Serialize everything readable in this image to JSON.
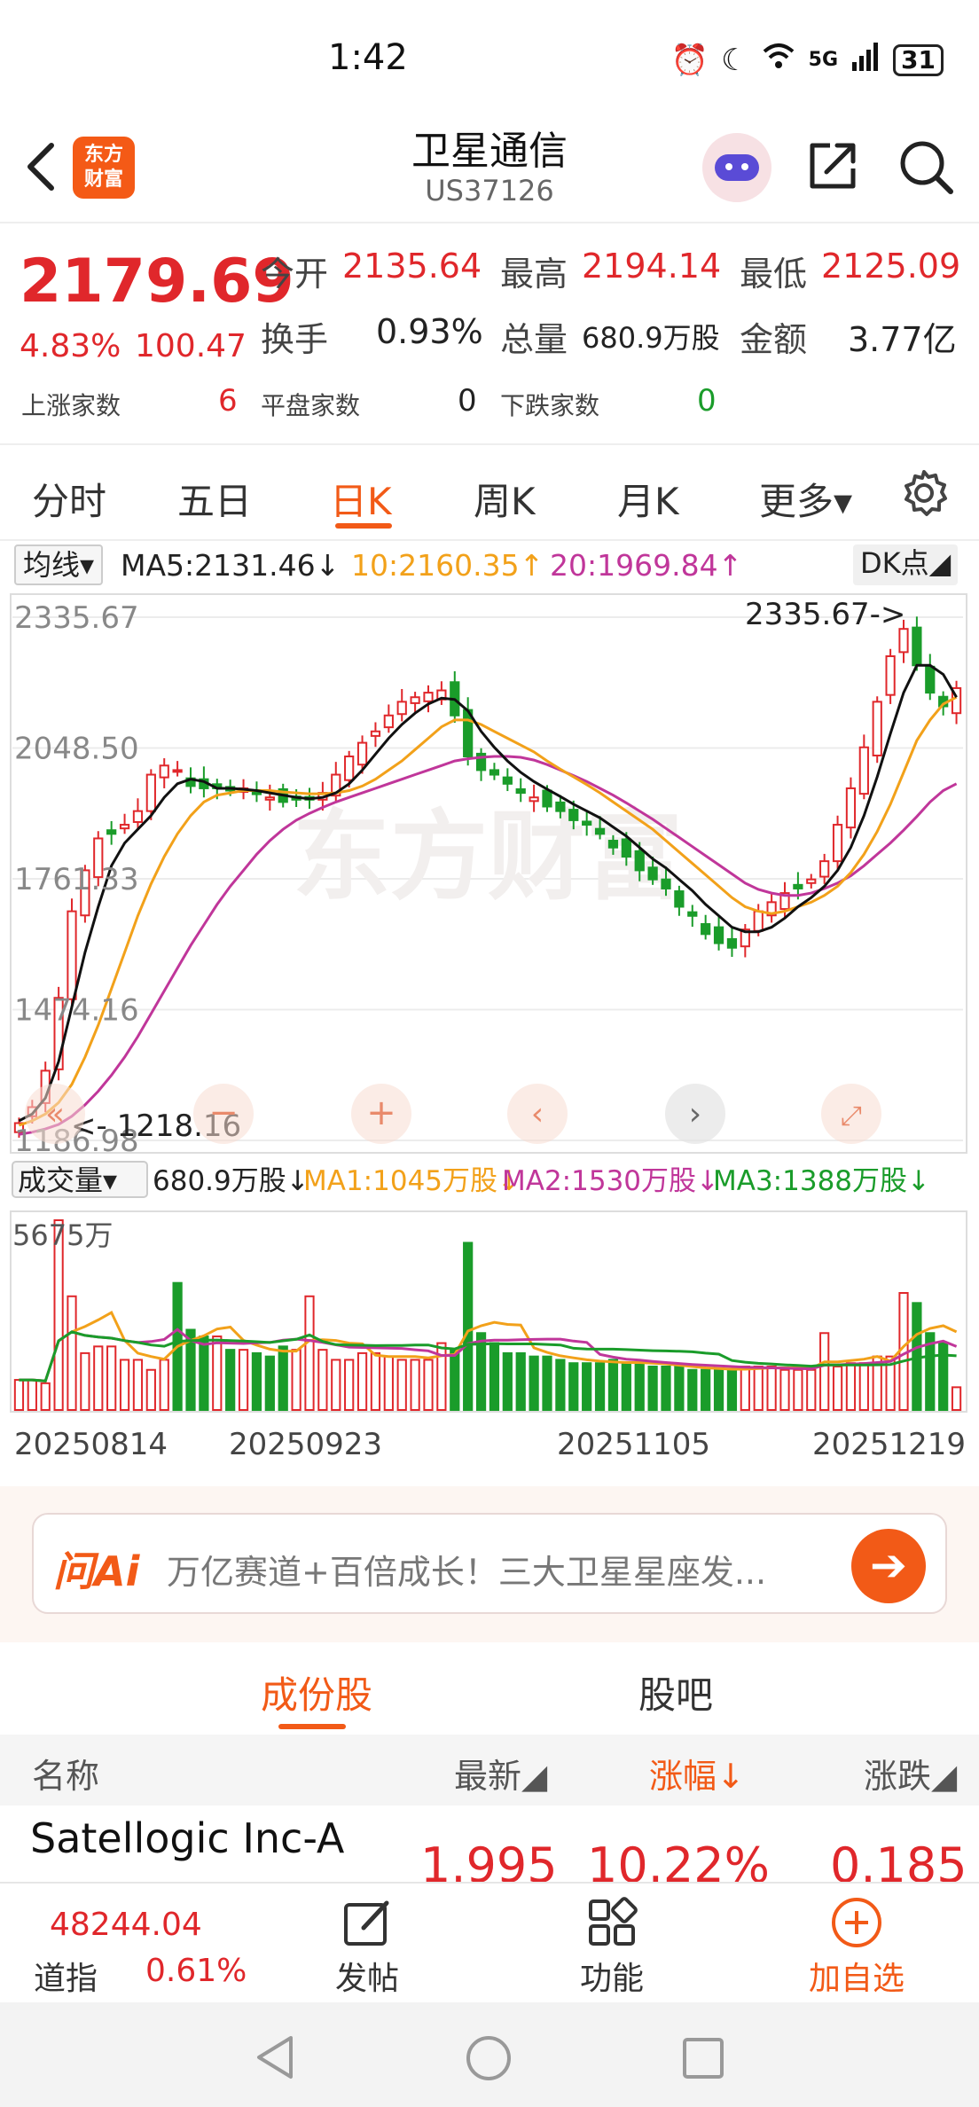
{
  "status_bar": {
    "time": "1:42",
    "signal": "5G",
    "battery": "31"
  },
  "header": {
    "logo": "东方\n财富",
    "title": "卫星通信",
    "code": "US37126"
  },
  "quote": {
    "price": "2179.69",
    "change_pct": "4.83%",
    "change": "100.47",
    "open_label": "今开",
    "open": "2135.64",
    "high_label": "最高",
    "high": "2194.14",
    "low_label": "最低",
    "low": "2125.09",
    "turnover_label": "换手",
    "turnover": "0.93%",
    "volume_label": "总量",
    "volume": "680.9万股",
    "amount_label": "金额",
    "amount": "3.77亿",
    "up_label": "上涨家数",
    "up": "6",
    "flat_label": "平盘家数",
    "flat": "0",
    "down_label": "下跌家数",
    "down": "0"
  },
  "ktabs": [
    "分时",
    "五日",
    "日K",
    "周K",
    "月K",
    "更多▾"
  ],
  "indicators": {
    "selector": "均线▾",
    "ma5": "MA5:2131.46↓",
    "ma10": "10:2160.35↑",
    "ma20": "20:1969.84↑",
    "dk": "DK点◢"
  },
  "volume_row": {
    "selector": "成交量▾",
    "vol": "680.9万股↓",
    "ma1": "MA1:1045万股↓",
    "ma2": "MA2:1530万股↓",
    "ma3": "MA3:1388万股↓"
  },
  "chart_data": {
    "type": "candlestick",
    "y_ticks": [
      "2335.67",
      "2048.50",
      "1761.33",
      "1474.16",
      "1186.98"
    ],
    "y_range": [
      1186.98,
      2335.67
    ],
    "max_annotation": "2335.67",
    "min_annotation": "1218.16",
    "watermark": "东方财富",
    "volume_max_label": "5675万",
    "x_labels": [
      "20250814",
      "20250923",
      "20251105",
      "20251219"
    ],
    "closes": [
      1225,
      1260,
      1340,
      1500,
      1690,
      1780,
      1850,
      1860,
      1880,
      1910,
      1990,
      2010,
      2000,
      1965,
      1960,
      1960,
      1955,
      1960,
      1950,
      1940,
      1930,
      1935,
      1935,
      1950,
      1990,
      2030,
      2060,
      2085,
      2120,
      2150,
      2160,
      2170,
      2175,
      2120,
      2030,
      2000,
      1990,
      1970,
      1950,
      1940,
      1920,
      1910,
      1890,
      1880,
      1860,
      1830,
      1810,
      1780,
      1760,
      1740,
      1700,
      1680,
      1640,
      1620,
      1610,
      1650,
      1690,
      1710,
      1730,
      1740,
      1760,
      1800,
      1880,
      1960,
      2050,
      2150,
      2250,
      2310,
      2230,
      2170,
      2140,
      2180
    ],
    "ma5": [
      1230,
      1245,
      1280,
      1360,
      1480,
      1600,
      1700,
      1790,
      1840,
      1870,
      1900,
      1940,
      1970,
      1980,
      1975,
      1960,
      1960,
      1958,
      1955,
      1950,
      1945,
      1940,
      1937,
      1940,
      1950,
      1970,
      2000,
      2035,
      2070,
      2100,
      2125,
      2145,
      2158,
      2155,
      2130,
      2085,
      2050,
      2020,
      1995,
      1975,
      1958,
      1942,
      1925,
      1910,
      1895,
      1875,
      1855,
      1830,
      1805,
      1785,
      1760,
      1735,
      1705,
      1680,
      1655,
      1645,
      1645,
      1655,
      1675,
      1700,
      1720,
      1745,
      1780,
      1830,
      1900,
      1985,
      2080,
      2170,
      2230,
      2230,
      2210,
      2160
    ],
    "ma10": [
      1220,
      1230,
      1245,
      1270,
      1310,
      1370,
      1440,
      1520,
      1600,
      1680,
      1750,
      1810,
      1860,
      1900,
      1930,
      1945,
      1950,
      1955,
      1955,
      1955,
      1952,
      1950,
      1948,
      1948,
      1950,
      1955,
      1965,
      1980,
      2000,
      2020,
      2045,
      2070,
      2095,
      2110,
      2110,
      2100,
      2085,
      2070,
      2055,
      2040,
      2020,
      2002,
      1985,
      1968,
      1950,
      1930,
      1910,
      1890,
      1870,
      1845,
      1820,
      1795,
      1770,
      1745,
      1720,
      1700,
      1690,
      1685,
      1690,
      1700,
      1710,
      1725,
      1745,
      1775,
      1815,
      1865,
      1925,
      1995,
      2065,
      2110,
      2145,
      2160
    ],
    "ma20": [
      1200,
      1205,
      1212,
      1222,
      1240,
      1265,
      1295,
      1330,
      1370,
      1415,
      1465,
      1515,
      1565,
      1615,
      1660,
      1705,
      1745,
      1780,
      1815,
      1845,
      1870,
      1890,
      1905,
      1918,
      1930,
      1940,
      1950,
      1960,
      1970,
      1980,
      1990,
      2000,
      2010,
      2020,
      2025,
      2028,
      2030,
      2030,
      2028,
      2022,
      2012,
      2000,
      1988,
      1975,
      1960,
      1945,
      1928,
      1910,
      1892,
      1872,
      1852,
      1832,
      1812,
      1792,
      1772,
      1752,
      1738,
      1730,
      1725,
      1725,
      1730,
      1740,
      1752,
      1768,
      1790,
      1815,
      1840,
      1868,
      1898,
      1930,
      1955,
      1970
    ],
    "volumes": [
      900,
      900,
      800,
      5675,
      3400,
      1700,
      1900,
      1900,
      1500,
      1500,
      1200,
      1500,
      3800,
      2400,
      2200,
      2200,
      1800,
      1800,
      1700,
      1600,
      1900,
      1800,
      3400,
      1800,
      1500,
      1500,
      1700,
      1700,
      1600,
      1500,
      1500,
      1500,
      2000,
      1800,
      5000,
      2300,
      2000,
      1700,
      1700,
      1600,
      1600,
      1500,
      1400,
      1400,
      1400,
      1500,
      1400,
      1400,
      1300,
      1300,
      1300,
      1200,
      1200,
      1200,
      1200,
      1300,
      1300,
      1300,
      1200,
      1200,
      1200,
      2300,
      1300,
      1400,
      1400,
      1600,
      1600,
      3500,
      3200,
      2300,
      2000,
      680
    ]
  },
  "ai_bar": {
    "logo": "问Ai",
    "text": "万亿赛道+百倍成长！三大卫星星座发..."
  },
  "component_tabs": [
    "成份股",
    "股吧"
  ],
  "table": {
    "headers": [
      "名称",
      "最新◢",
      "涨幅↓",
      "涨跌◢"
    ],
    "rows": [
      {
        "name": "Satellogic Inc-A",
        "last": "1.995",
        "pct": "10.22%",
        "chg": "0.185"
      }
    ]
  },
  "bottom_nav": {
    "index_value": "48244.04",
    "index_name": "道指",
    "index_pct": "0.61%",
    "post": "发帖",
    "functions": "功能",
    "add": "加自选"
  },
  "colors": {
    "up": "#e0272b",
    "down": "#1a9c2a",
    "accent": "#f25a17",
    "ma5": "#111111",
    "ma10": "#f2a11a",
    "ma20": "#c0369a",
    "vma3": "#1a9c2a"
  }
}
